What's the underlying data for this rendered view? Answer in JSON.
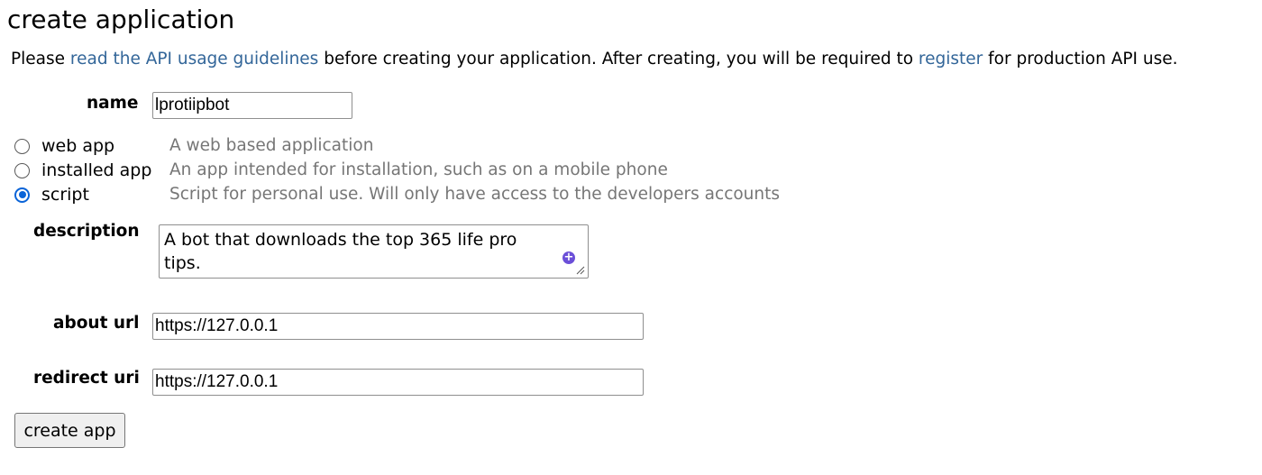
{
  "page": {
    "title": "create application"
  },
  "intro": {
    "text_1": "Please ",
    "link_guidelines": "read the API usage guidelines",
    "text_2": " before creating your application. After creating, you will be required to ",
    "link_register": "register",
    "text_3": " for production API use.",
    "link_color": "#336699"
  },
  "form": {
    "name_label": "name",
    "name_value": "lprotiipbot",
    "app_types": [
      {
        "label": "web app",
        "help": "A web based application",
        "checked": false
      },
      {
        "label": "installed app",
        "help": "An app intended for installation, such as on a mobile phone",
        "checked": false
      },
      {
        "label": "script",
        "help": "Script for personal use. Will only have access to the developers accounts",
        "checked": true
      }
    ],
    "description_label": "description",
    "description_value": "A bot that downloads the top 365 life pro tips.",
    "about_url_label": "about url",
    "about_url_value": "https://127.0.0.1",
    "redirect_uri_label": "redirect uri",
    "redirect_uri_value": "https://127.0.0.1",
    "submit_label": "create app"
  },
  "colors": {
    "radio_checked": "#0a64d8",
    "help_text": "#767676",
    "grammar_icon": "#6b4fd8"
  },
  "icons": {
    "grammar_icon": "plus-circle-icon",
    "resize_icon": "resize-handle-icon"
  }
}
